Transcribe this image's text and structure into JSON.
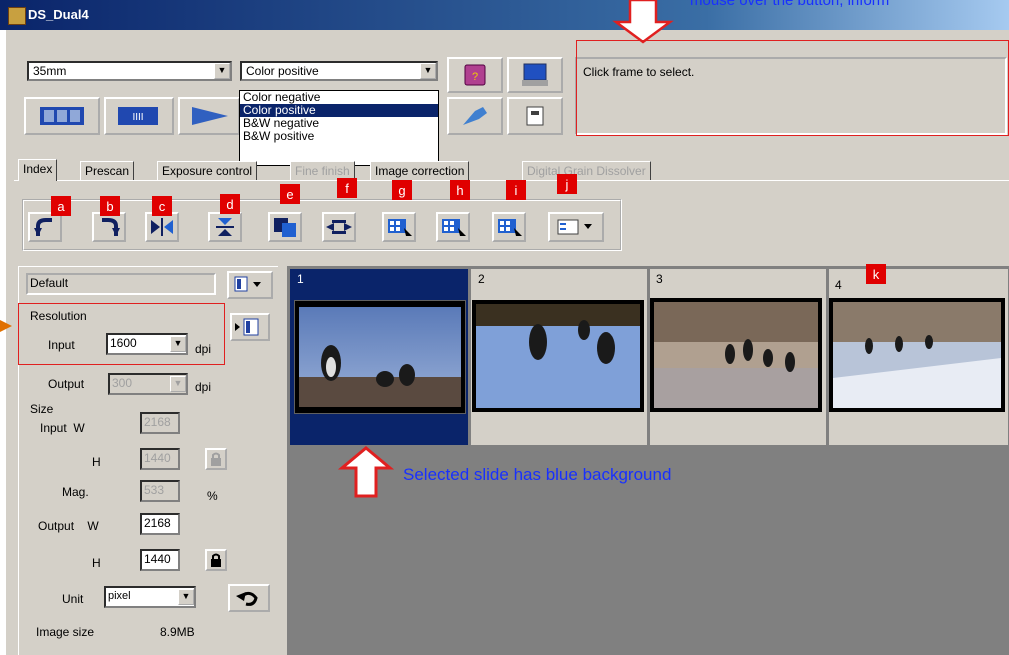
{
  "window": {
    "title": "DS_Dual4"
  },
  "top_callout": "mouse over the button, inform",
  "toolbar": {
    "film_type": "35mm",
    "film_mode": "Color positive",
    "film_mode_options": [
      "Color negative",
      "Color positive",
      "B&W negative",
      "B&W positive"
    ],
    "message": "Click frame to select."
  },
  "tabs": [
    "Index",
    "Prescan",
    "Exposure control",
    "Fine finish",
    "Image correction",
    "Digital Grain Dissolver"
  ],
  "button_labels": [
    "a",
    "b",
    "c",
    "d",
    "e",
    "f",
    "g",
    "h",
    "i",
    "j",
    "k"
  ],
  "left_panel": {
    "preset": "Default",
    "resolution_heading": "Resolution",
    "input_label": "Input",
    "input_dpi": "1600",
    "dpi_unit": "dpi",
    "output_label": "Output",
    "output_dpi": "300",
    "size_heading": "Size",
    "input_w_label": "Input  W",
    "input_w": "2168",
    "h_label": "H",
    "input_h": "1440",
    "mag_label": "Mag.",
    "mag": "533",
    "percent": "%",
    "output_w_label": "Output    W",
    "output_w": "2168",
    "output_h": "1440",
    "unit_label": "Unit",
    "unit_value": "pixel",
    "image_size_label": "Image size",
    "image_size": "8.9MB"
  },
  "frames": [
    {
      "number": "1",
      "selected": true
    },
    {
      "number": "2",
      "selected": false
    },
    {
      "number": "3",
      "selected": false
    },
    {
      "number": "4",
      "selected": false
    }
  ],
  "selected_annotation": "Selected slide has blue background",
  "colors": {
    "selection_blue": "#0a246a",
    "callout_red": "#e00000",
    "annotation_blue": "#1830ff",
    "panel_gray": "#d4d0c8",
    "viewer_gray": "#808080"
  }
}
